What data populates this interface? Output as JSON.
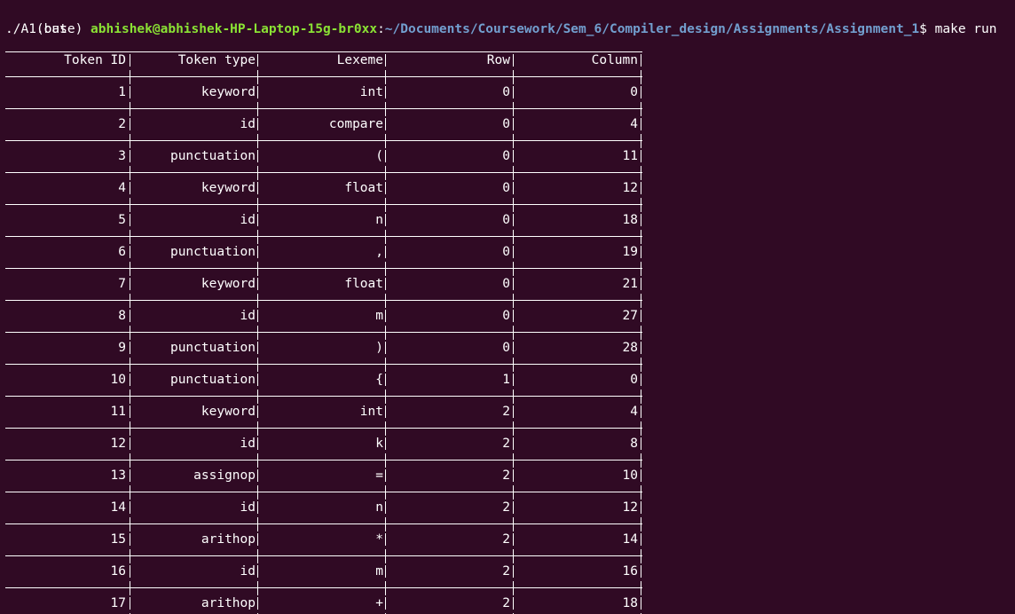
{
  "prompt": {
    "env": "(base)",
    "user_host": "abhishek@abhishek-HP-Laptop-15g-br0xx",
    "colon": ":",
    "path": "~/Documents/Coursework/Sem_6/Compiler_design/Assignments/Assignment_1",
    "symbol": "$",
    "command": "make run"
  },
  "output_line": "./A1.out",
  "table": {
    "headers": [
      "Token ID",
      "Token type",
      "Lexeme",
      "Row",
      "Column"
    ],
    "rows": [
      [
        "1",
        "keyword",
        "int",
        "0",
        "0"
      ],
      [
        "2",
        "id",
        "compare",
        "0",
        "4"
      ],
      [
        "3",
        "punctuation",
        "(",
        "0",
        "11"
      ],
      [
        "4",
        "keyword",
        "float",
        "0",
        "12"
      ],
      [
        "5",
        "id",
        "n",
        "0",
        "18"
      ],
      [
        "6",
        "punctuation",
        ",",
        "0",
        "19"
      ],
      [
        "7",
        "keyword",
        "float",
        "0",
        "21"
      ],
      [
        "8",
        "id",
        "m",
        "0",
        "27"
      ],
      [
        "9",
        "punctuation",
        ")",
        "0",
        "28"
      ],
      [
        "10",
        "punctuation",
        "{",
        "1",
        "0"
      ],
      [
        "11",
        "keyword",
        "int",
        "2",
        "4"
      ],
      [
        "12",
        "id",
        "k",
        "2",
        "8"
      ],
      [
        "13",
        "assignop",
        "=",
        "2",
        "10"
      ],
      [
        "14",
        "id",
        "n",
        "2",
        "12"
      ],
      [
        "15",
        "arithop",
        "*",
        "2",
        "14"
      ],
      [
        "16",
        "id",
        "m",
        "2",
        "16"
      ],
      [
        "17",
        "arithop",
        "+",
        "2",
        "18"
      ]
    ]
  },
  "colors": {
    "background": "#300a24",
    "user_host": "#8ae234",
    "path": "#729fcf",
    "text": "#ffffff"
  }
}
